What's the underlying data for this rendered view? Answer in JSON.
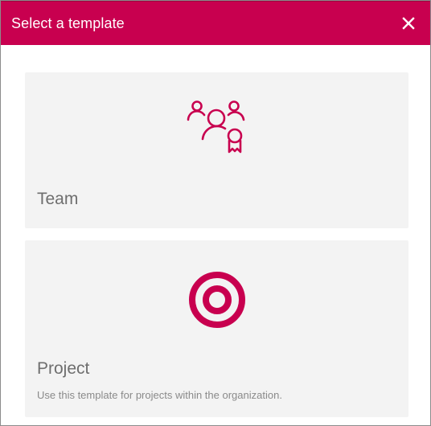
{
  "dialog": {
    "title": "Select a template",
    "close_icon": "close-icon",
    "accent_color": "#c8004f"
  },
  "templates": [
    {
      "label": "Team",
      "icon": "team-icon",
      "description": ""
    },
    {
      "label": "Project",
      "icon": "target-icon",
      "description": "Use this template for projects within the organization."
    }
  ]
}
